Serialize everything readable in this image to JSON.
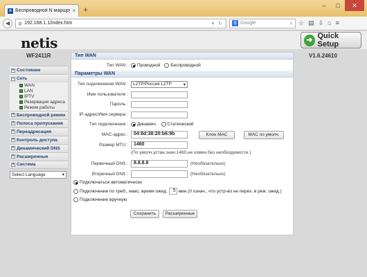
{
  "browser": {
    "tab_title": "Беспроводной N маршрутиз...",
    "url": "192.168.1.1/index.htm",
    "search_placeholder": "Google"
  },
  "header": {
    "logo": "netis",
    "quick_setup": "Quick Setup",
    "model": "WF2411R",
    "version": "V1.6.24610"
  },
  "sidebar": {
    "items": [
      {
        "label": "Состояние",
        "toggle": "+"
      },
      {
        "label": "Сеть",
        "toggle": "−"
      },
      {
        "label": "Беспроводной режим",
        "toggle": "+"
      },
      {
        "label": "Полоса пропускания",
        "toggle": "+"
      },
      {
        "label": "Переадресация",
        "toggle": "+"
      },
      {
        "label": "Контроль доступа",
        "toggle": "+"
      },
      {
        "label": "Динамический DNS",
        "toggle": "+"
      },
      {
        "label": "Расширенные",
        "toggle": "+"
      },
      {
        "label": "Система",
        "toggle": "+"
      }
    ],
    "network_sub": [
      "WAN",
      "LAN",
      "IPTV",
      "Резервация адреса",
      "Режим работы"
    ],
    "language": "Select Language"
  },
  "wan_type": {
    "section": "Тип WAN",
    "label": "Тип WAN :",
    "option_wired": "Проводной",
    "option_wireless": "Беспроводной",
    "selected": "Проводной"
  },
  "wan_params": {
    "section": "Параметры WAN",
    "conn_type_label": "Тип подключения WAN :",
    "conn_type_value": "L2TP/Россия L2TP",
    "username_label": "Имя пользователя :",
    "password_label": "Пароль :",
    "server_label": "IP-адрес/Имя сервера :",
    "conn_mode_label": "Тип подключения :",
    "conn_mode_dynamic": "Динамич.",
    "conn_mode_static": "Статический",
    "mac_label": "MAC-адрес :",
    "mac_value": "04:8d:38:20:b6:9b",
    "clone_mac": "Клон MAC",
    "default_mac": "MAC по умолч.",
    "mtu_label": "Размер MTU :",
    "mtu_value": "1460",
    "mtu_note": "(По умолч.устан.знач.1460,не измен.без необходимости.)",
    "dns1_label": "Первичный DNS :",
    "dns1_value": "8.8.8.8",
    "dns1_note": "(Необязательно)",
    "dns2_label": "Вторичный DNS :",
    "dns2_value": "",
    "dns2_note": "(Необязательно)",
    "connect_auto": "Подключаться автоматически",
    "connect_on_demand": "Подключение по треб., макс. время ожид.",
    "idle_value": "5",
    "idle_note": "мин.(0 означ., что устр-во не перех. в реж. ожид.)",
    "connect_manual": "Подключение вручную",
    "save": "Сохранить",
    "advanced": "Расширенные"
  }
}
